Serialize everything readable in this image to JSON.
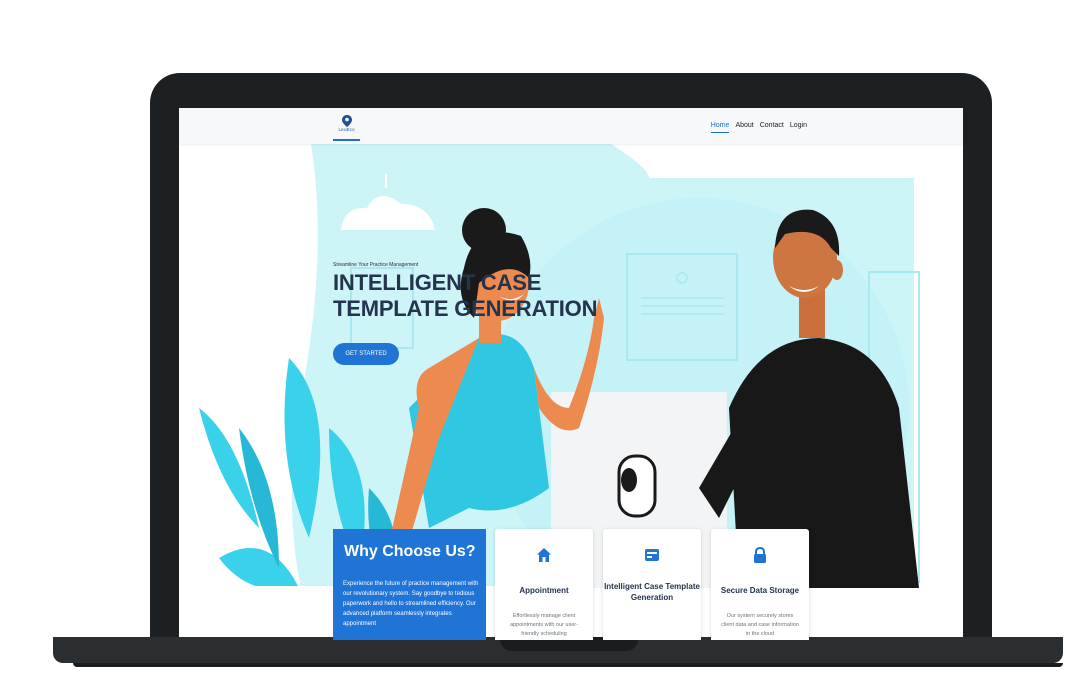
{
  "navbar": {
    "brand": "LexiEco",
    "links": [
      "Home",
      "About",
      "Contact",
      "Login"
    ]
  },
  "hero": {
    "tagline": "Streamline Your Practice Management",
    "headline_line1": "INTELLIGENT CASE",
    "headline_line2": "TEMPLATE GENERATION",
    "cta": "GET STARTED"
  },
  "why": {
    "title": "Why Choose Us?",
    "text": "Experience the future of practice management with our revolutionary system. Say goodbye to tedious paperwork and hello to streamlined efficiency. Our advanced platform seamlessly integrates appointment"
  },
  "cards": [
    {
      "icon": "house-icon",
      "title": "Appointment",
      "text": "Effortlessly manage client appointments with our user-friendly scheduling"
    },
    {
      "icon": "form-icon",
      "title": "Intelligent Case Template Generation",
      "text": ""
    },
    {
      "icon": "lock-icon",
      "title": "Secure Data Storage",
      "text": "Our system securely stores client data and case information in the cloud"
    }
  ],
  "colors": {
    "accent": "#2074d6",
    "heading": "#24344d",
    "bezel": "#1c2023",
    "sky": "#cdf5f8"
  }
}
